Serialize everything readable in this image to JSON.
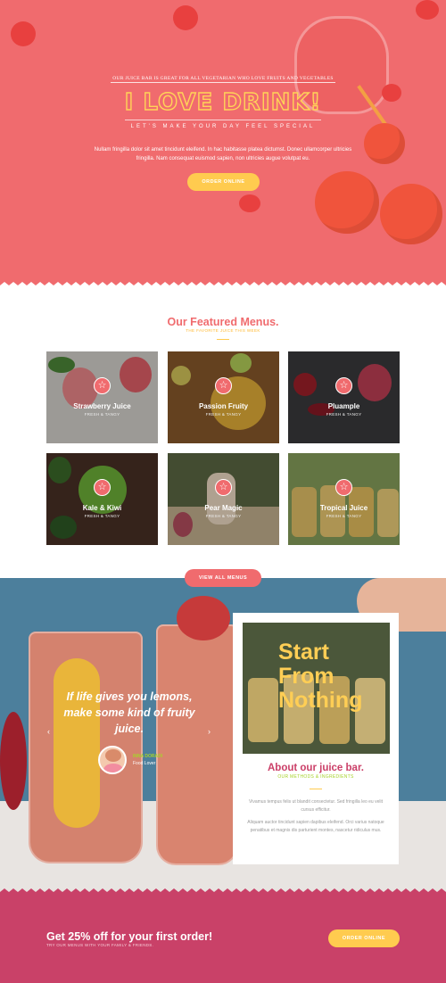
{
  "hero": {
    "intro": "OUR JUICE BAR IS GREAT FOR ALL VEGETARIAN WHO LOVE FRUITS AND VEGETABLES",
    "title": "I LOVE DRINK!",
    "subtitle": "LET'S MAKE YOUR DAY FEEL SPECIAL",
    "text": "Nullam fringilla dolor sit amet tincidunt eleifend. In hac habitasse platea dictumst. Donec ullamcorper ultricies fringilla. Nam consequat euismod sapien, non ultricies augue volutpat eu.",
    "button": "ORDER ONLINE"
  },
  "featured": {
    "title": "Our Featured Menus.",
    "subtitle": "THE FAVORITE JUICE THIS WEEK",
    "badge_icon": "star-icon",
    "items": [
      {
        "name": "Strawberry Juice",
        "tag": "FRESH & TANGY"
      },
      {
        "name": "Passion Fruity",
        "tag": "FRESH & TANGY"
      },
      {
        "name": "Pluample",
        "tag": "FRESH & TANGY"
      },
      {
        "name": "Kale & Kiwi",
        "tag": "FRESH & TANGY"
      },
      {
        "name": "Pear Magic",
        "tag": "FRESH & TANGY"
      },
      {
        "name": "Tropical Juice",
        "tag": "FRESH & TANGY"
      }
    ],
    "button": "VIEW ALL MENUS"
  },
  "testimonial": {
    "quote": "If life gives you lemons, make some kind of fruity juice.",
    "author": "INNA DORADI",
    "role": "Food Lover",
    "prev_icon": "chevron-left-icon",
    "next_icon": "chevron-right-icon"
  },
  "about": {
    "image_text": "Start From Nothing",
    "title": "About our juice bar.",
    "subtitle": "OUR METHODS & INGREDIENTS",
    "p1": "Vivamus tempus felis ut blandit consectetur. Sed fringilla leo eu velit cursus efficitur.",
    "p2": "Aliquam auctor tincidunt sapien dapibus eleifend. Orci varius natoque penatibus et magnis dis parturient montes, nascetur ridiculus mus."
  },
  "offer": {
    "title": "Get 25% off for your first order!",
    "subtitle": "TRY OUR MENUS WITH YOUR FAMILY & FRIENDS.",
    "button": "ORDER ONLINE"
  },
  "colors": {
    "primary": "#f06b6e",
    "accent": "#ffcb4f",
    "green": "#a7d22b",
    "magenta": "#c94168"
  }
}
